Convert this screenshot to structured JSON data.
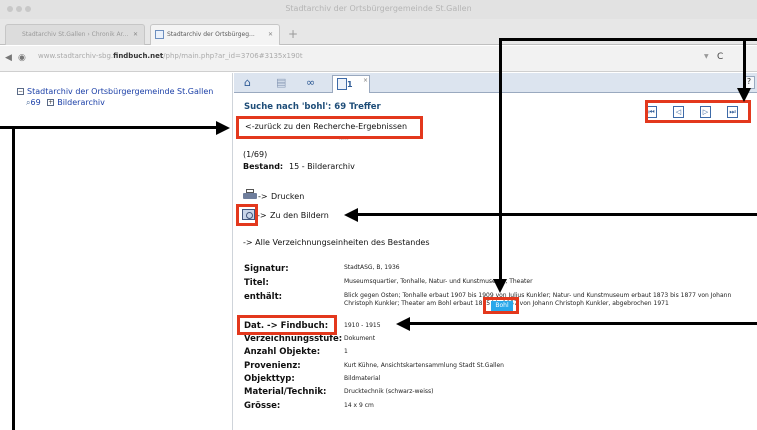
{
  "window": {
    "title": "Stadtarchiv der Ortsbürgergemeinde St.Gallen"
  },
  "browser_tabs": [
    {
      "label": "Stadtarchiv St.Gallen › Chronik Ar..."
    },
    {
      "label": "Stadtarchiv der Ortsbürgeg..."
    }
  ],
  "address": {
    "prefix": "www.stadtarchiv-sbg.",
    "domain": "findbuch.net",
    "path": "/php/main.php?ar_id=3706#3135x190t"
  },
  "tree": {
    "root_label": "Stadtarchiv der Ortsbürgergemeinde St.Gallen",
    "child_count": "69",
    "child_label": "Bilderarchiv"
  },
  "main": {
    "tab_number": "1",
    "help": "?",
    "search_title": "Suche nach 'bohl': 69 Treffer",
    "back_link": "<-zurück zu den Recherche-Ergebnissen",
    "count": "(1/69)",
    "bestand_label": "Bestand:",
    "bestand_value": "15 - Bilderarchiv",
    "print_arrow": "->",
    "print_label": "Drucken",
    "images_arrow": "->",
    "images_label": "Zu den Bildern",
    "all_units": "-> Alle Verzeichnungseinheiten des Bestandes",
    "pager_caption": "Next"
  },
  "record": {
    "signatur_label": "Signatur:",
    "signatur_value": "StadtASG, B, 1936",
    "titel_label": "Titel:",
    "titel_value": "Museumsquartier, Tonhalle, Natur- und Kunstmuseum, Theater",
    "enthaelt_label": "enthält:",
    "enthaelt_value": "Blick gegen Osten; Tonhalle erbaut 1907 bis 1909 von Julius Kunkler; Natur- und Kunstmuseum erbaut 1873 bis 1877 von Johann Christoph Kunkler; Theater am Bohl erbaut 1855 bis 1857 von Johann Christoph Kunkler, abgebrochen 1971",
    "highlight_word": "Bohl",
    "dat_label": "Dat. -> Findbuch:",
    "dat_value": "1910 - 1915",
    "stufe_label": "Verzeichnungsstufe:",
    "stufe_value": "Dokument",
    "anzahl_label": "Anzahl Objekte:",
    "anzahl_value": "1",
    "provenienz_label": "Provenienz:",
    "provenienz_value": "Kurt Kühne, Ansichtskartensammlung Stadt St.Gallen",
    "objekttyp_label": "Objekttyp:",
    "objekttyp_value": "Bildmaterial",
    "material_label": "Material/Technik:",
    "material_value": "Drucktechnik (schwarz-weiss)",
    "groesse_label": "Grösse:",
    "groesse_value": "14 x 9 cm"
  },
  "colors": {
    "highlight": "#e3381d",
    "link_blue": "#1c40a8",
    "search_hit": "#29a8ea",
    "heading_blue": "#1e4d78"
  },
  "icons": [
    "home-icon",
    "list-icon",
    "binoculars-icon",
    "document-icon",
    "printer-icon",
    "images-icon",
    "first-page-icon",
    "previous-page-icon",
    "next-page-icon",
    "last-page-icon"
  ]
}
